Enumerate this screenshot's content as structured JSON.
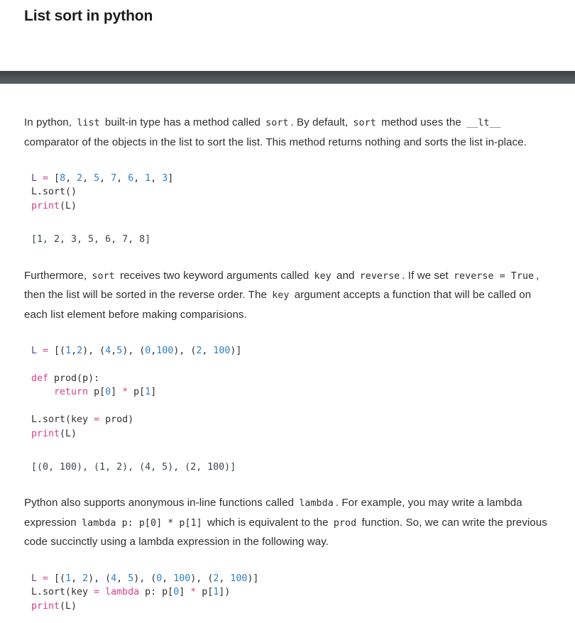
{
  "document": {
    "title": "List sort in python"
  },
  "sections": [
    {
      "type": "paragraph",
      "name": "intro-paragraph",
      "parts": [
        {
          "kind": "text",
          "value": "In python, "
        },
        {
          "kind": "code",
          "value": "list"
        },
        {
          "kind": "text",
          "value": " built-in type has a method called "
        },
        {
          "kind": "code",
          "value": "sort"
        },
        {
          "kind": "text",
          "value": ". By default, "
        },
        {
          "kind": "code",
          "value": "sort"
        },
        {
          "kind": "text",
          "value": " method uses the "
        },
        {
          "kind": "code",
          "value": "__lt__"
        },
        {
          "kind": "text",
          "value": " comparator of the objects in the list to sort the list. This method returns nothing and sorts the list in-place."
        }
      ],
      "plain": "In python, list built-in type has a method called sort . By default, sort method uses the __lt__ comparator of the objects in the list to sort the list. This method returns nothing and sorts the list in-place."
    },
    {
      "type": "code",
      "name": "code-block-1",
      "lines": [
        [
          {
            "t": "name",
            "v": "L"
          },
          {
            "t": "plain",
            "v": " "
          },
          {
            "t": "op",
            "v": "="
          },
          {
            "t": "plain",
            "v": " ["
          },
          {
            "t": "num",
            "v": "8"
          },
          {
            "t": "plain",
            "v": ", "
          },
          {
            "t": "num",
            "v": "2"
          },
          {
            "t": "plain",
            "v": ", "
          },
          {
            "t": "num",
            "v": "5"
          },
          {
            "t": "plain",
            "v": ", "
          },
          {
            "t": "num",
            "v": "7"
          },
          {
            "t": "plain",
            "v": ", "
          },
          {
            "t": "num",
            "v": "6"
          },
          {
            "t": "plain",
            "v": ", "
          },
          {
            "t": "num",
            "v": "1"
          },
          {
            "t": "plain",
            "v": ", "
          },
          {
            "t": "num",
            "v": "3"
          },
          {
            "t": "plain",
            "v": "]"
          }
        ],
        [
          {
            "t": "plain",
            "v": "L.sort()"
          }
        ],
        [
          {
            "t": "fn",
            "v": "print"
          },
          {
            "t": "plain",
            "v": "(L)"
          }
        ]
      ],
      "plain": "L = [8, 2, 5, 7, 6, 1, 3]\nL.sort()\nprint(L)"
    },
    {
      "type": "output",
      "name": "output-block-1",
      "text": "[1, 2, 3, 5, 6, 7, 8]"
    },
    {
      "type": "paragraph",
      "name": "keyword-arguments-paragraph",
      "parts": [
        {
          "kind": "text",
          "value": "Furthermore, "
        },
        {
          "kind": "code",
          "value": "sort"
        },
        {
          "kind": "text",
          "value": " receives two keyword arguments called "
        },
        {
          "kind": "code",
          "value": "key"
        },
        {
          "kind": "text",
          "value": " and "
        },
        {
          "kind": "code",
          "value": "reverse"
        },
        {
          "kind": "text",
          "value": ". If we set "
        },
        {
          "kind": "code",
          "value": "reverse = True"
        },
        {
          "kind": "text",
          "value": ", then the list will be sorted in the reverse order. The "
        },
        {
          "kind": "code",
          "value": "key"
        },
        {
          "kind": "text",
          "value": " argument accepts a function that will be called on each list element before making comparisions."
        }
      ],
      "plain": "Furthermore, sort receives two keyword arguments called key and reverse . If we set reverse = True , then the list will be sorted in the reverse order. The key argument accepts a function that will be called on each list element before making comparisions."
    },
    {
      "type": "code",
      "name": "code-block-2",
      "lines": [
        [
          {
            "t": "name",
            "v": "L"
          },
          {
            "t": "plain",
            "v": " "
          },
          {
            "t": "op",
            "v": "="
          },
          {
            "t": "plain",
            "v": " [("
          },
          {
            "t": "num",
            "v": "1"
          },
          {
            "t": "plain",
            "v": ","
          },
          {
            "t": "num",
            "v": "2"
          },
          {
            "t": "plain",
            "v": "), ("
          },
          {
            "t": "num",
            "v": "4"
          },
          {
            "t": "plain",
            "v": ","
          },
          {
            "t": "num",
            "v": "5"
          },
          {
            "t": "plain",
            "v": "), ("
          },
          {
            "t": "num",
            "v": "0"
          },
          {
            "t": "plain",
            "v": ","
          },
          {
            "t": "num",
            "v": "100"
          },
          {
            "t": "plain",
            "v": "), ("
          },
          {
            "t": "num",
            "v": "2"
          },
          {
            "t": "plain",
            "v": ", "
          },
          {
            "t": "num",
            "v": "100"
          },
          {
            "t": "plain",
            "v": ")]"
          }
        ],
        [
          {
            "t": "plain",
            "v": ""
          }
        ],
        [
          {
            "t": "kw",
            "v": "def"
          },
          {
            "t": "plain",
            "v": " prod(p):"
          }
        ],
        [
          {
            "t": "plain",
            "v": "    "
          },
          {
            "t": "kw",
            "v": "return"
          },
          {
            "t": "plain",
            "v": " p["
          },
          {
            "t": "num",
            "v": "0"
          },
          {
            "t": "plain",
            "v": "] "
          },
          {
            "t": "op",
            "v": "*"
          },
          {
            "t": "plain",
            "v": " p["
          },
          {
            "t": "num",
            "v": "1"
          },
          {
            "t": "plain",
            "v": "]"
          }
        ],
        [
          {
            "t": "plain",
            "v": ""
          }
        ],
        [
          {
            "t": "plain",
            "v": "L.sort(key "
          },
          {
            "t": "op",
            "v": "="
          },
          {
            "t": "plain",
            "v": " prod)"
          }
        ],
        [
          {
            "t": "fn",
            "v": "print"
          },
          {
            "t": "plain",
            "v": "(L)"
          }
        ]
      ],
      "plain": "L = [(1,2), (4,5), (0,100), (2, 100)]\n\ndef prod(p):\n    return p[0] * p[1]\n\nL.sort(key = prod)\nprint(L)"
    },
    {
      "type": "output",
      "name": "output-block-2",
      "text": "[(0, 100), (1, 2), (4, 5), (2, 100)]"
    },
    {
      "type": "paragraph",
      "name": "lambda-paragraph",
      "parts": [
        {
          "kind": "text",
          "value": "Python also supports anonymous in-line functions called "
        },
        {
          "kind": "code",
          "value": "lambda"
        },
        {
          "kind": "text",
          "value": ". For example, you may write a lambda expression "
        },
        {
          "kind": "code",
          "value": "lambda p: p[0] * p[1]"
        },
        {
          "kind": "text",
          "value": " which is equivalent to the "
        },
        {
          "kind": "code",
          "value": "prod"
        },
        {
          "kind": "text",
          "value": " function. So, we can write the previous code succinctly using a lambda expression in the following way."
        }
      ],
      "plain": "Python also supports anonymous in-line functions called lambda . For example, you may write a lambda expression lambda p: p[0] * p[1] which is equivalent to the prod function. So, we can write the previous code succinctly using a lambda expression in the following way."
    },
    {
      "type": "code",
      "name": "code-block-3",
      "lines": [
        [
          {
            "t": "name",
            "v": "L"
          },
          {
            "t": "plain",
            "v": " "
          },
          {
            "t": "op",
            "v": "="
          },
          {
            "t": "plain",
            "v": " [("
          },
          {
            "t": "num",
            "v": "1"
          },
          {
            "t": "plain",
            "v": ", "
          },
          {
            "t": "num",
            "v": "2"
          },
          {
            "t": "plain",
            "v": "), ("
          },
          {
            "t": "num",
            "v": "4"
          },
          {
            "t": "plain",
            "v": ", "
          },
          {
            "t": "num",
            "v": "5"
          },
          {
            "t": "plain",
            "v": "), ("
          },
          {
            "t": "num",
            "v": "0"
          },
          {
            "t": "plain",
            "v": ", "
          },
          {
            "t": "num",
            "v": "100"
          },
          {
            "t": "plain",
            "v": "), ("
          },
          {
            "t": "num",
            "v": "2"
          },
          {
            "t": "plain",
            "v": ", "
          },
          {
            "t": "num",
            "v": "100"
          },
          {
            "t": "plain",
            "v": ")]"
          }
        ],
        [
          {
            "t": "plain",
            "v": "L.sort(key "
          },
          {
            "t": "op",
            "v": "="
          },
          {
            "t": "plain",
            "v": " "
          },
          {
            "t": "kw",
            "v": "lambda"
          },
          {
            "t": "plain",
            "v": " p: p["
          },
          {
            "t": "num",
            "v": "0"
          },
          {
            "t": "plain",
            "v": "] "
          },
          {
            "t": "op",
            "v": "*"
          },
          {
            "t": "plain",
            "v": " p["
          },
          {
            "t": "num",
            "v": "1"
          },
          {
            "t": "plain",
            "v": "])"
          }
        ],
        [
          {
            "t": "fn",
            "v": "print"
          },
          {
            "t": "plain",
            "v": "(L)"
          }
        ]
      ],
      "plain": "L = [(1, 2), (4, 5), (0, 100), (2, 100)]\nL.sort(key = lambda p: p[0] * p[1])\nprint(L)"
    }
  ],
  "colors": {
    "separator_bar": "#4a5054",
    "text": "#2e2e2e",
    "title": "#1b1b1b",
    "syntax_name": "#5c3d8f",
    "syntax_operator": "#d1438f",
    "syntax_number": "#2b7fc4",
    "syntax_keyword": "#d5408c",
    "syntax_function": "#d5408c",
    "output_text": "#37474f",
    "background": "#ffffff"
  }
}
